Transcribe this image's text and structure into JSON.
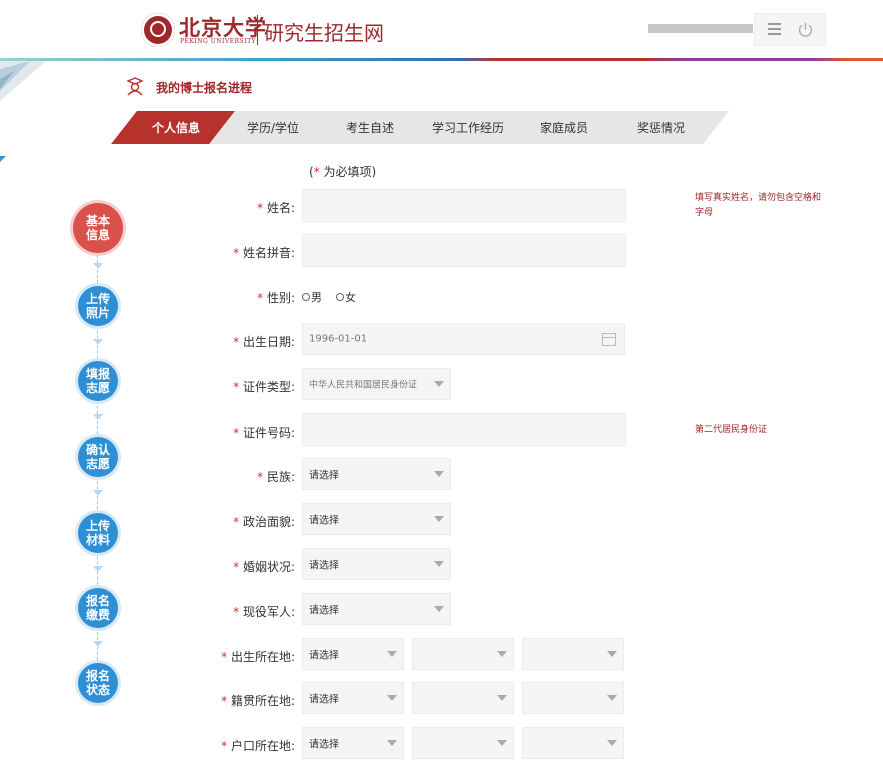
{
  "header": {
    "logo_cn": "北京大学",
    "logo_en": "PEKING UNIVERSITY",
    "site_title": "研究生招生网",
    "menu_icon": "menu-icon",
    "power_icon": "power-icon"
  },
  "progress": {
    "title": "我的博士报名进程",
    "icon": "graduate-icon"
  },
  "tabs": [
    {
      "label": "个人信息",
      "active": true
    },
    {
      "label": "学历/学位"
    },
    {
      "label": "考生自述"
    },
    {
      "label": "学习工作经历"
    },
    {
      "label": "家庭成员"
    },
    {
      "label": "奖惩情况"
    }
  ],
  "steps": [
    {
      "label": "基本信息",
      "active": true
    },
    {
      "label": "上传照片"
    },
    {
      "label": "填报志愿"
    },
    {
      "label": "确认志愿"
    },
    {
      "label": "上传材料"
    },
    {
      "label": "报名缴费"
    },
    {
      "label": "报名状态"
    }
  ],
  "form": {
    "required_note_star": "*",
    "required_note": " 为必填项)",
    "required_note_open": "(",
    "name_label": "姓名:",
    "name_hint": "填写真实姓名，请勿包含空格和字母",
    "pinyin_label": "姓名拼音:",
    "gender_label": "性别:",
    "gender_male": "男",
    "gender_female": "女",
    "birth_label": "出生日期:",
    "birth_value": "1996-01-01",
    "idtype_label": "证件类型:",
    "idtype_value": "中华人民共和国居民身份证",
    "idno_label": "证件号码:",
    "idno_hint": "第二代居民身份证",
    "nation_label": "民族:",
    "political_label": "政治面貌:",
    "marital_label": "婚姻状况:",
    "military_label": "现役军人:",
    "birthplace_label": "出生所在地:",
    "native_label": "籍贯所在地:",
    "hukou_label": "户口所在地:",
    "select_placeholder": "请选择",
    "star": "*"
  },
  "colors": {
    "accent": "#b7322c",
    "step_blue": "#2f8fd4",
    "step_active": "#d9514a"
  }
}
